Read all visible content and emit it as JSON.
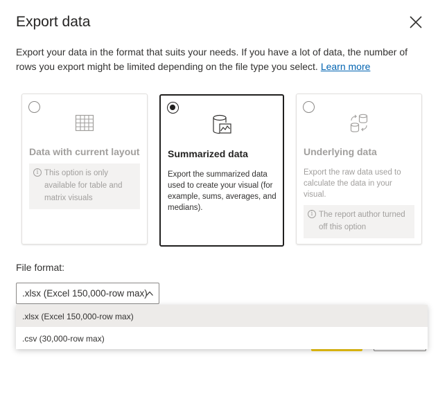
{
  "dialog": {
    "title": "Export data",
    "description": "Export your data in the format that suits your needs. If you have a lot of data, the number of rows you export might be limited depending on the file type you select.",
    "learn_more": "Learn more"
  },
  "options": [
    {
      "title": "Data with current layout",
      "icon": "table-icon",
      "selected": false,
      "disabled": true,
      "info": "This option is only available for table and matrix visuals"
    },
    {
      "title": "Summarized data",
      "icon": "summarized-data-icon",
      "selected": true,
      "disabled": false,
      "description": "Export the summarized data used to create your visual (for example, sums, averages, and medians)."
    },
    {
      "title": "Underlying data",
      "icon": "underlying-data-icon",
      "selected": false,
      "disabled": true,
      "description": "Export the raw data used to calculate the data in your visual.",
      "info": "The report author turned off this option"
    }
  ],
  "file_format": {
    "label": "File format:",
    "selected": ".xlsx (Excel 150,000-row max)",
    "options": [
      ".xlsx (Excel 150,000-row max)",
      ".csv (30,000-row max)"
    ]
  },
  "colors": {
    "accent_button": "#f2c811",
    "link": "#0063b1",
    "dropdown_highlight": "#edebe9"
  }
}
